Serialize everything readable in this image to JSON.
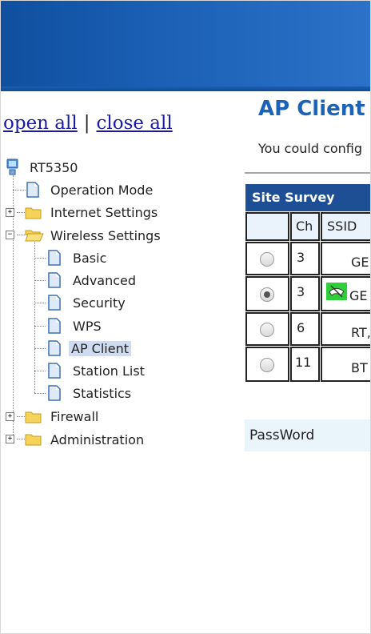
{
  "tree_links": {
    "open_all": "open all",
    "separator": "|",
    "close_all": "close all"
  },
  "tree": {
    "root": "RT5350",
    "operation_mode": "Operation Mode",
    "internet_settings": "Internet Settings",
    "wireless_settings": "Wireless Settings",
    "basic": "Basic",
    "advanced": "Advanced",
    "security": "Security",
    "wps": "WPS",
    "ap_client": "AP Client",
    "station_list": "Station List",
    "statistics": "Statistics",
    "firewall": "Firewall",
    "administration": "Administration",
    "selected": "AP Client",
    "expand_symbol": "+",
    "collapse_symbol": "−"
  },
  "content": {
    "title": "AP Client F",
    "description": "You could config",
    "site_survey": {
      "header": "Site Survey",
      "columns": [
        "Ch",
        "SSID"
      ],
      "rows": [
        {
          "selected": false,
          "channel": "3",
          "ssid": "GE",
          "has_icon": false
        },
        {
          "selected": true,
          "channel": "3",
          "ssid": "GE",
          "has_icon": true
        },
        {
          "selected": false,
          "channel": "6",
          "ssid": "RT,",
          "has_icon": false
        },
        {
          "selected": false,
          "channel": "11",
          "ssid": "BT",
          "has_icon": false
        }
      ]
    },
    "password_label": "PassWord"
  },
  "colors": {
    "banner": "#1a5fb4",
    "title": "#1a63b8",
    "survey_header": "#1e4f95",
    "link": "#1a1aa6",
    "selected_bg": "#cfdcf0"
  }
}
